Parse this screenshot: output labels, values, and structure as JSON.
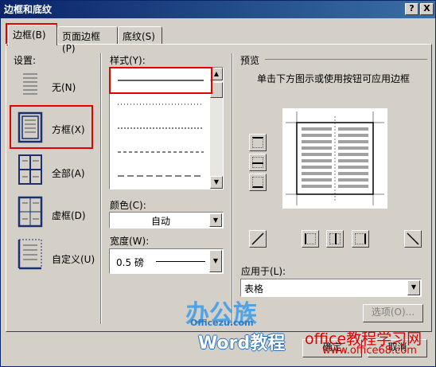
{
  "window": {
    "title": "边框和底纹",
    "help_btn": "?",
    "close_btn": "X"
  },
  "tabs": [
    {
      "label": "边框(B)"
    },
    {
      "label": "页面边框(P)"
    },
    {
      "label": "底纹(S)"
    }
  ],
  "settings": {
    "heading": "设置:",
    "items": [
      {
        "label": "无(N)"
      },
      {
        "label": "方框(X)"
      },
      {
        "label": "全部(A)"
      },
      {
        "label": "虚框(D)"
      },
      {
        "label": "自定义(U)"
      }
    ]
  },
  "style": {
    "heading": "样式(Y):"
  },
  "color": {
    "heading": "颜色(C):",
    "value": "自动"
  },
  "width": {
    "heading": "宽度(W):",
    "value": "0.5 磅"
  },
  "preview": {
    "heading": "预览",
    "hint": "单击下方图示或使用按钮可应用边框"
  },
  "apply_to": {
    "heading": "应用于(L):",
    "value": "表格"
  },
  "buttons": {
    "options": "选项(O)...",
    "ok": "确定",
    "cancel": "取消"
  },
  "watermark": {
    "brand": "办公族",
    "site": "Officezu.com",
    "word": "Word教程",
    "red_title": "office教程学习网",
    "red_url": "www.office68.com"
  }
}
